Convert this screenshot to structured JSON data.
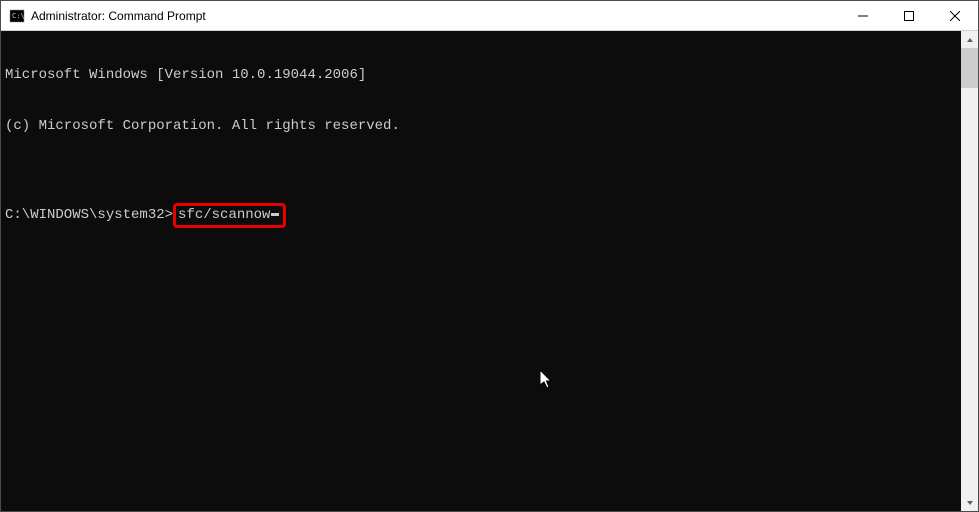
{
  "window": {
    "title": "Administrator: Command Prompt"
  },
  "terminal": {
    "line1": "Microsoft Windows [Version 10.0.19044.2006]",
    "line2": "(c) Microsoft Corporation. All rights reserved.",
    "blank": "",
    "prompt": "C:\\WINDOWS\\system32>",
    "command": "sfc/scannow"
  }
}
